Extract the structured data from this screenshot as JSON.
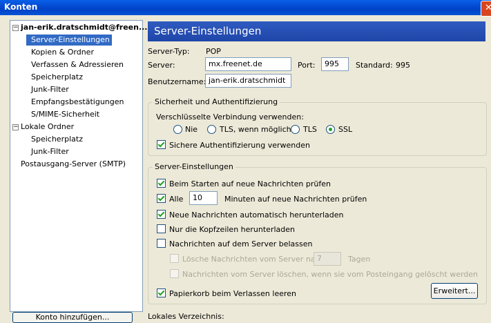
{
  "window": {
    "title": "Konten",
    "close": "✕"
  },
  "tree": {
    "account1": "jan-erik.dratschmidt@freen...",
    "account1_items": [
      "Server-Einstellungen",
      "Kopien & Ordner",
      "Verfassen & Adressieren",
      "Speicherplatz",
      "Junk-Filter",
      "Empfangsbestätigungen",
      "S/MIME-Sicherheit"
    ],
    "account2": "Lokale Ordner",
    "account2_items": [
      "Speicherplatz",
      "Junk-Filter"
    ],
    "smtp": "Postausgang-Server (SMTP)",
    "add_account": "Konto hinzufügen..."
  },
  "header": {
    "title": "Server-Einstellungen"
  },
  "server": {
    "type_label": "Server-Typ:",
    "type_value": "POP",
    "server_label": "Server:",
    "server_value": "mx.freenet.de",
    "port_label": "Port:",
    "port_value": "995",
    "standard_label": "Standard:",
    "standard_value": "995",
    "user_label": "Benutzername:",
    "user_value": "jan-erik.dratschmidt"
  },
  "security": {
    "legend": "Sicherheit und Authentifizierung",
    "encrypted_label": "Verschlüsselte Verbindung verwenden:",
    "options": [
      "Nie",
      "TLS, wenn möglich",
      "TLS",
      "SSL"
    ],
    "selected": "SSL",
    "secure_auth": "Sichere Authentifizierung verwenden"
  },
  "settings": {
    "legend": "Server-Einstellungen",
    "check_on_start": "Beim Starten auf neue Nachrichten prüfen",
    "every": "Alle",
    "minutes_value": "10",
    "minutes_suffix": "Minuten auf neue Nachrichten prüfen",
    "auto_download": "Neue Nachrichten automatisch herunterladen",
    "headers_only": "Nur die Kopfzeilen herunterladen",
    "leave_on_server": "Nachrichten auf dem Server belassen",
    "delete_after": "Lösche Nachrichten vom Server nach",
    "days_value": "7",
    "days_suffix": "Tagen",
    "delete_when_deleted": "Nachrichten vom Server löschen, wenn sie vom Posteingang gelöscht werden",
    "empty_trash": "Papierkorb beim Verlassen leeren",
    "advanced": "Erweitert..."
  },
  "local_dir_label": "Lokales Verzeichnis:"
}
